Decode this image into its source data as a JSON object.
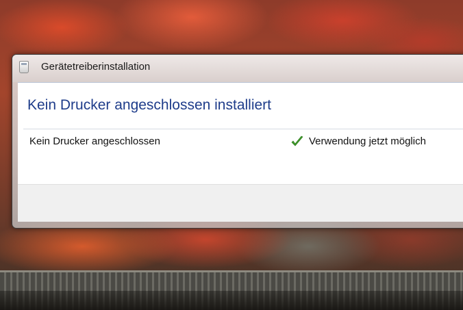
{
  "window": {
    "title": "Gerätetreiberinstallation"
  },
  "main": {
    "heading": "Kein Drucker angeschlossen installiert",
    "devices": [
      {
        "name": "Kein Drucker angeschlossen",
        "status": "Verwendung jetzt möglich",
        "status_icon": "green-checkmark-icon"
      }
    ]
  },
  "colors": {
    "heading": "#1e3c8a",
    "check": "#3f9a2a"
  }
}
